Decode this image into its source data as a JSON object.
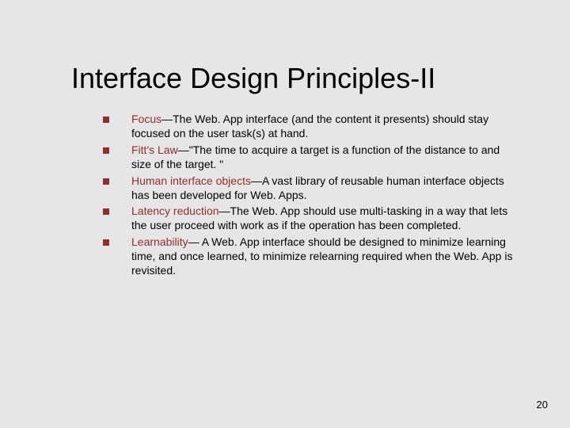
{
  "title": "Interface Design Principles-II",
  "bullets": [
    {
      "term": "Focus",
      "rest": "—The Web. App interface (and the content it presents) should stay focused on the user task(s) at hand."
    },
    {
      "term": "Fitt's Law",
      "rest": "—\"The time to acquire a target is a function of the distance to and size of the target. \""
    },
    {
      "term": "Human interface objects",
      "rest": "—A vast library of reusable human interface objects has been developed for Web. Apps."
    },
    {
      "term": "Latency reduction",
      "rest": "—The Web. App should use multi-tasking in a way that lets the user proceed with work as if the operation has been completed."
    },
    {
      "term": "Learnability",
      "rest": "— A Web. App interface should be designed to minimize learning time, and once learned, to minimize relearning required when the Web. App is revisited."
    }
  ],
  "page_number": "20"
}
